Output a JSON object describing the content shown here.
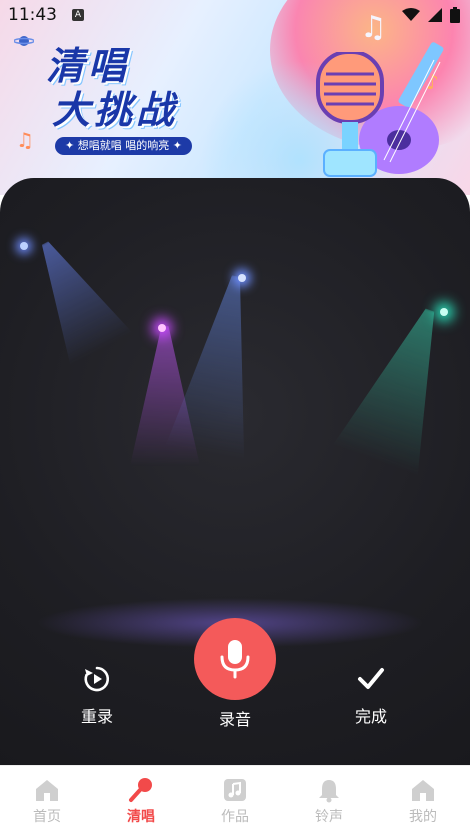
{
  "status_bar": {
    "time": "11:43",
    "badge": "A"
  },
  "banner": {
    "title_line1": "清唱",
    "title_line2": "大挑战",
    "slogan": "✦ 想唱就唱 唱的响亮 ✦"
  },
  "controls": {
    "rerecord_label": "重录",
    "record_label": "录音",
    "done_label": "完成"
  },
  "nav": {
    "items": [
      {
        "label": "首页",
        "icon": "home-icon",
        "active": false
      },
      {
        "label": "清唱",
        "icon": "mic-icon",
        "active": true
      },
      {
        "label": "作品",
        "icon": "music-note-icon",
        "active": false
      },
      {
        "label": "铃声",
        "icon": "bell-icon",
        "active": false
      },
      {
        "label": "我的",
        "icon": "user-icon",
        "active": false
      }
    ]
  },
  "colors": {
    "accent": "#f45a5a",
    "title_blue": "#1a37a8",
    "nav_inactive": "#bbbbbb"
  }
}
